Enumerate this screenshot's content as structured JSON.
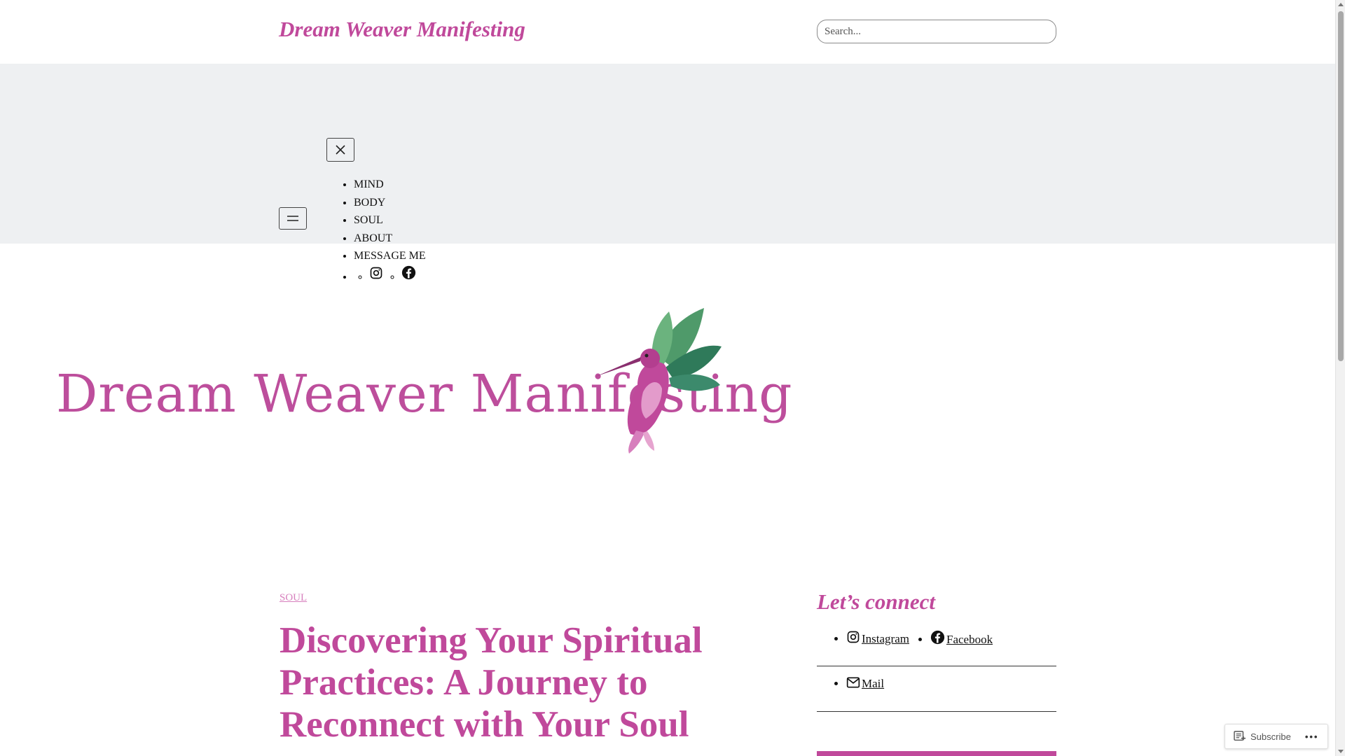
{
  "header": {
    "site_title": "Dream Weaver Manifesting",
    "search_placeholder": "Search..."
  },
  "nav": {
    "items": [
      {
        "label": "MIND"
      },
      {
        "label": "BODY"
      },
      {
        "label": "SOUL"
      },
      {
        "label": "ABOUT"
      },
      {
        "label": "MESSAGE ME"
      }
    ],
    "social_icons": [
      "instagram-icon",
      "facebook-icon"
    ]
  },
  "banner": {
    "logo_text": "Dream Weaver Manifesting"
  },
  "post": {
    "category": "SOUL",
    "title": "Discovering Your Spiritual Practices: A Journey to Reconnect with Your Soul"
  },
  "sidebar": {
    "heading": "Let’s connect",
    "links": [
      {
        "label": "Instagram",
        "icon": "instagram-icon"
      },
      {
        "label": "Facebook",
        "icon": "facebook-icon"
      },
      {
        "label": "Mail",
        "icon": "mail-icon"
      }
    ]
  },
  "subscribe": {
    "label": "Subscribe",
    "more": "•••"
  },
  "colors": {
    "accent": "#c0499b",
    "nav_bg": "#eef0f2",
    "category_link": "#d77fbd"
  }
}
